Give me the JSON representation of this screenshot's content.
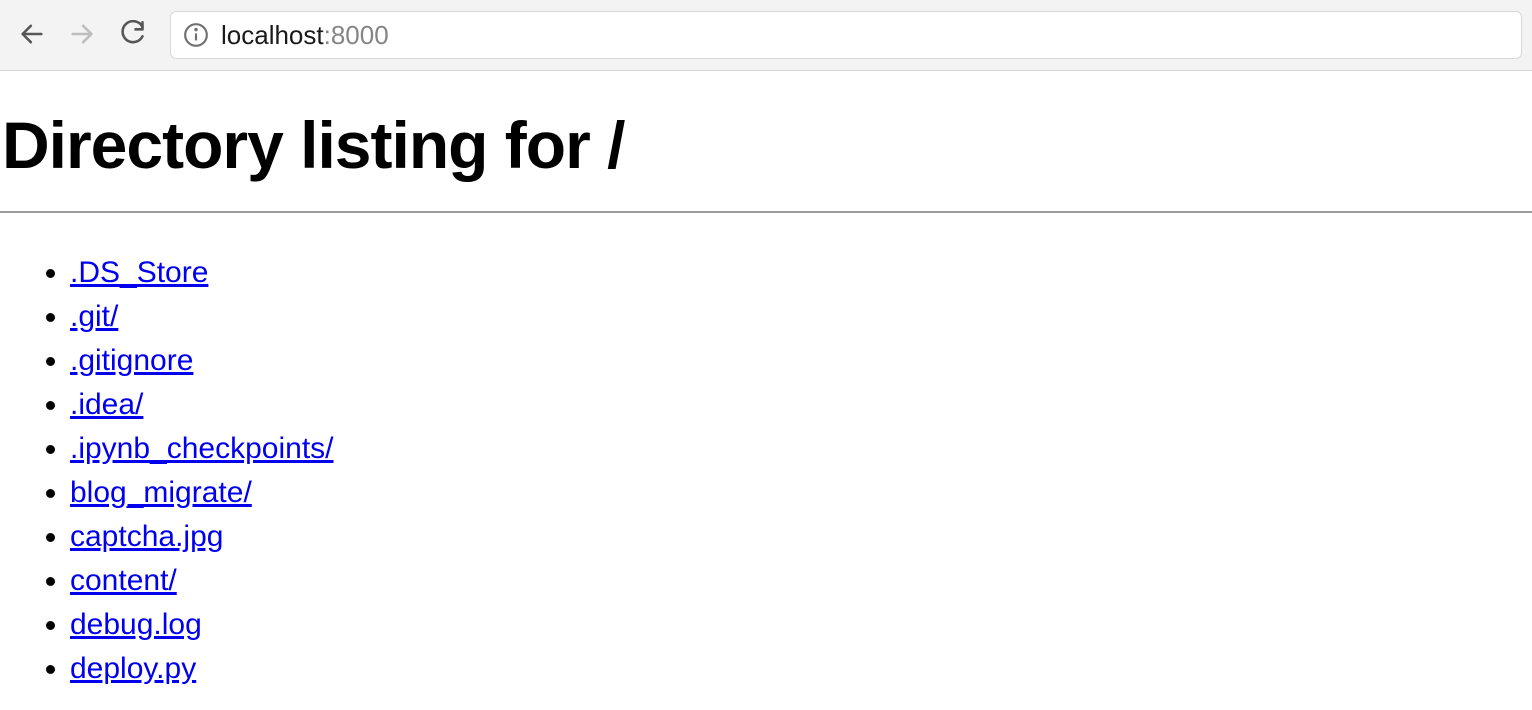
{
  "toolbar": {
    "url_host": "localhost",
    "url_port": ":8000"
  },
  "page": {
    "title": "Directory listing for /",
    "entries": [
      ".DS_Store",
      ".git/",
      ".gitignore",
      ".idea/",
      ".ipynb_checkpoints/",
      "blog_migrate/",
      "captcha.jpg",
      "content/",
      "debug.log",
      "deploy.py"
    ]
  }
}
